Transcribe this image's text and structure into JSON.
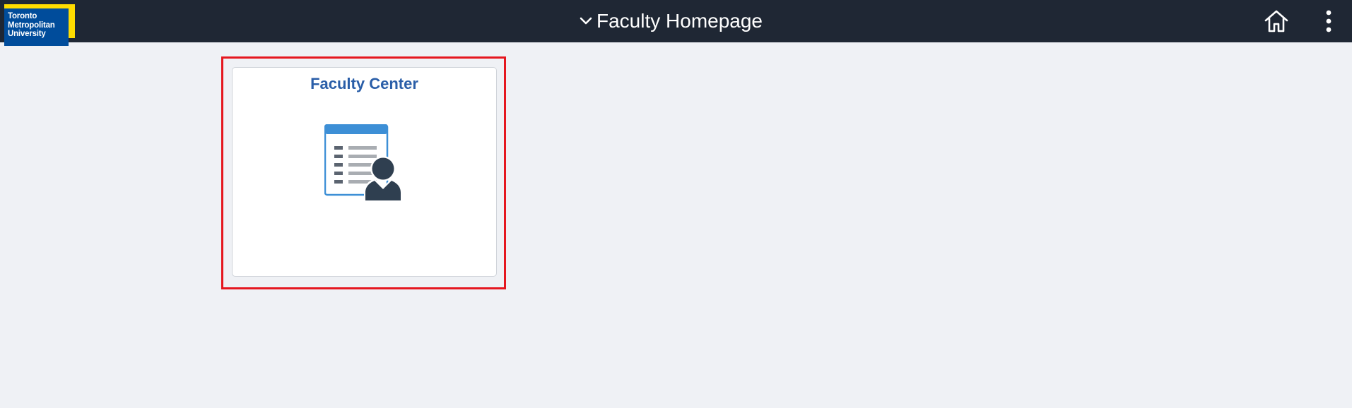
{
  "banner": {
    "logo": {
      "line1": "Toronto",
      "line2": "Metropolitan",
      "line3": "University"
    },
    "title": "Faculty Homepage",
    "icons": {
      "title_dropdown": "chevron-down-icon",
      "home": "home-icon",
      "actions": "vertical-dots-icon"
    }
  },
  "tiles": [
    {
      "title": "Faculty Center",
      "icon": "faculty-roster-icon",
      "highlighted": true
    }
  ],
  "colors": {
    "banner_bg": "#1f2734",
    "page_bg": "#eff1f5",
    "tile_title": "#2a5ea8",
    "highlight_border": "#e5171f",
    "logo_blue": "#004c9b",
    "logo_yellow": "#ffdc00"
  }
}
